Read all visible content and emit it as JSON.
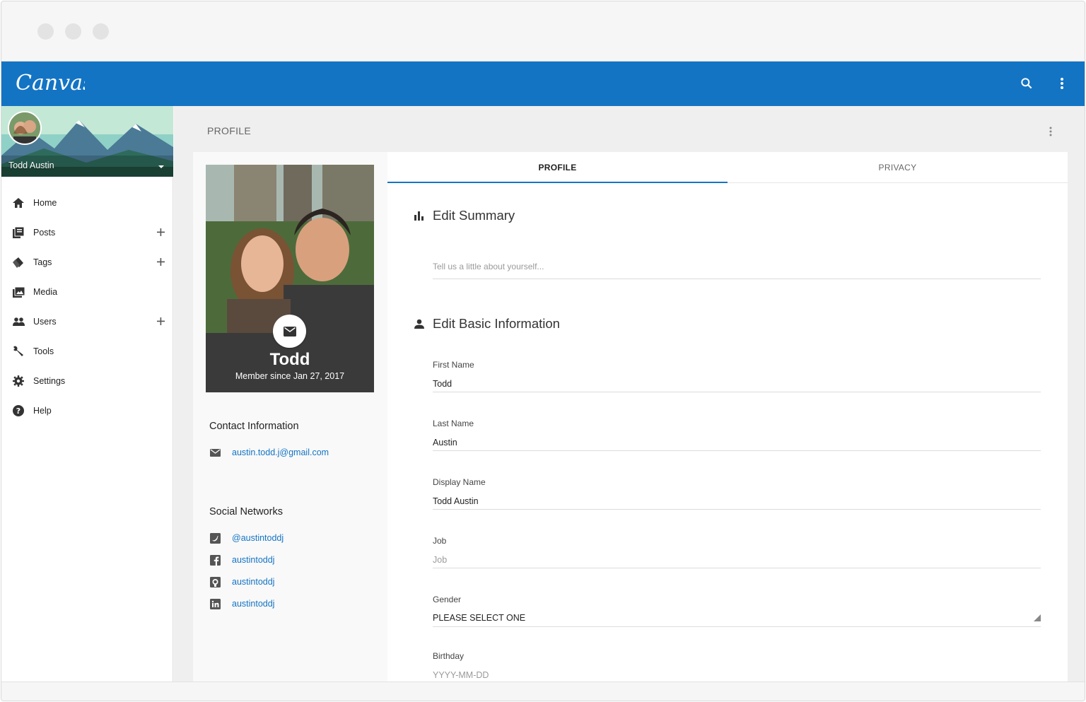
{
  "app": {
    "logo_text": "Canvas"
  },
  "user": {
    "name": "Todd Austin"
  },
  "sidebar": {
    "items": [
      {
        "label": "Home",
        "icon": "home-icon",
        "has_add": false
      },
      {
        "label": "Posts",
        "icon": "posts-icon",
        "has_add": true
      },
      {
        "label": "Tags",
        "icon": "tags-icon",
        "has_add": true
      },
      {
        "label": "Media",
        "icon": "media-icon",
        "has_add": false
      },
      {
        "label": "Users",
        "icon": "users-icon",
        "has_add": true
      },
      {
        "label": "Tools",
        "icon": "wrench-icon",
        "has_add": false
      },
      {
        "label": "Settings",
        "icon": "gear-icon",
        "has_add": false
      },
      {
        "label": "Help",
        "icon": "help-icon",
        "has_add": false
      }
    ]
  },
  "main": {
    "breadcrumb": "PROFILE"
  },
  "profile_card": {
    "name": "Todd",
    "member_since": "Member since Jan 27, 2017",
    "contact_heading": "Contact Information",
    "email": "austin.todd.j@gmail.com",
    "social_heading": "Social Networks",
    "social": [
      {
        "network": "twitter",
        "handle": "@austintoddj"
      },
      {
        "network": "facebook",
        "handle": "austintoddj"
      },
      {
        "network": "github",
        "handle": "austintoddj"
      },
      {
        "network": "linkedin",
        "handle": "austintoddj"
      }
    ]
  },
  "tabs": [
    {
      "label": "PROFILE",
      "active": true
    },
    {
      "label": "PRIVACY",
      "active": false
    }
  ],
  "summary": {
    "title": "Edit Summary",
    "placeholder": "Tell us a little about yourself..."
  },
  "basic": {
    "title": "Edit Basic Information",
    "first_name": {
      "label": "First Name",
      "value": "Todd"
    },
    "last_name": {
      "label": "Last Name",
      "value": "Austin"
    },
    "display_name": {
      "label": "Display Name",
      "value": "Todd Austin"
    },
    "job": {
      "label": "Job",
      "placeholder": "Job"
    },
    "gender": {
      "label": "Gender",
      "value": "PLEASE SELECT ONE"
    },
    "birthday": {
      "label": "Birthday",
      "placeholder": "YYYY-MM-DD"
    }
  },
  "colors": {
    "primary": "#1374c4",
    "active_tab_text": "#222222",
    "inactive_tab_text": "#666666"
  }
}
